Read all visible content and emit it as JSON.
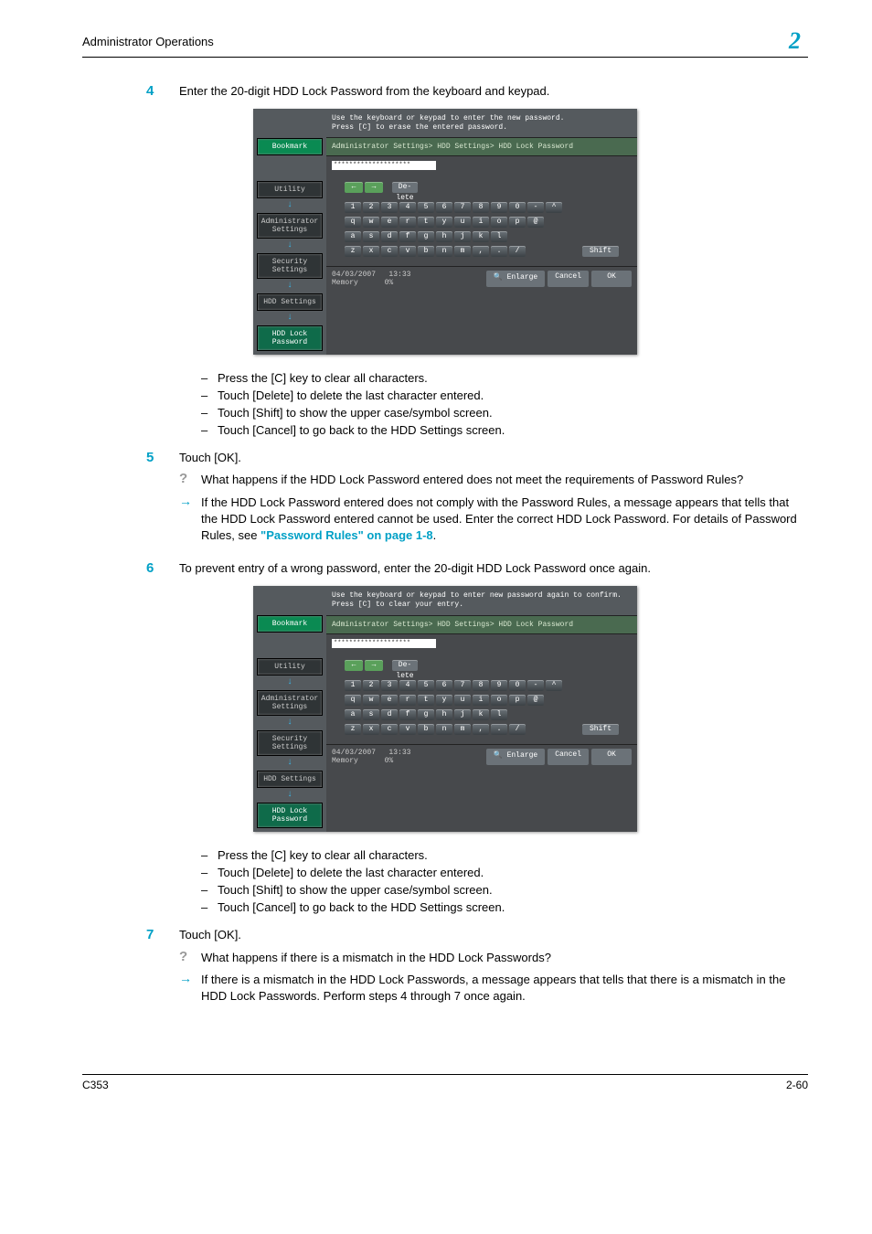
{
  "header": {
    "title": "Administrator Operations",
    "chapter": "2"
  },
  "steps": {
    "s4": {
      "num": "4",
      "text": "Enter the 20-digit HDD Lock Password from the keyboard and keypad."
    },
    "s5": {
      "num": "5",
      "text": "Touch [OK]."
    },
    "s6": {
      "num": "6",
      "text": "To prevent entry of a wrong password, enter the 20-digit HDD Lock Password once again."
    },
    "s7": {
      "num": "7",
      "text": "Touch [OK]."
    }
  },
  "bullets4": {
    "b1": "Press the [C] key to clear all characters.",
    "b2": "Touch [Delete] to delete the last character entered.",
    "b3": "Touch [Shift] to show the upper case/symbol screen.",
    "b4": "Touch [Cancel] to go back to the HDD Settings screen."
  },
  "bullets6": {
    "b1": "Press the [C] key to clear all characters.",
    "b2": "Touch [Delete] to delete the last character entered.",
    "b3": "Touch [Shift] to show the upper case/symbol screen.",
    "b4": "Touch [Cancel] to go back to the HDD Settings screen."
  },
  "qa5": {
    "q": "What happens if the HDD Lock Password entered does not meet the requirements of Password Rules?",
    "a_pre": "If the HDD Lock Password entered does not comply with the Password Rules, a message appears that tells that the HDD Lock Password entered cannot be used. Enter the correct HDD Lock Password. For details of Password Rules, see ",
    "a_link": "\"Password Rules\" on page 1-8",
    "a_post": "."
  },
  "qa7": {
    "q": "What happens if there is a mismatch in the HDD Lock Passwords?",
    "a": "If there is a mismatch in the HDD Lock Passwords, a message appears that tells that there is a mismatch in the HDD Lock Passwords. Perform steps 4 through 7 once again."
  },
  "panel": {
    "msg1": "Use the keyboard or keypad to enter the new password.\nPress [C] to erase the entered password.",
    "msg2": "Use the keyboard or keypad to enter new password again to confirm.\nPress [C] to clear your entry.",
    "nav": {
      "bookmark": "Bookmark",
      "utility": "Utility",
      "admin": "Administrator\nSettings",
      "security": "Security\nSettings",
      "hdd": "HDD Settings",
      "lock": "HDD Lock\nPassword"
    },
    "crumb": "Administrator Settings> HDD Settings> HDD Lock Password",
    "mask": "********************",
    "del": "De-lete",
    "row1": [
      "1",
      "2",
      "3",
      "4",
      "5",
      "6",
      "7",
      "8",
      "9",
      "0",
      "-",
      "^"
    ],
    "row2": [
      "q",
      "w",
      "e",
      "r",
      "t",
      "y",
      "u",
      "i",
      "o",
      "p",
      "@"
    ],
    "row3": [
      "a",
      "s",
      "d",
      "f",
      "g",
      "h",
      "j",
      "k",
      "l"
    ],
    "row4": [
      "z",
      "x",
      "c",
      "v",
      "b",
      "n",
      "m",
      ",",
      ".",
      "/"
    ],
    "shift": "Shift",
    "status": {
      "date": "04/03/2007",
      "time": "13:33",
      "memlabel": "Memory",
      "mem": "0%",
      "enlarge": "Enlarge",
      "cancel": "Cancel",
      "ok": "OK"
    }
  },
  "footer": {
    "left": "C353",
    "right": "2-60"
  }
}
